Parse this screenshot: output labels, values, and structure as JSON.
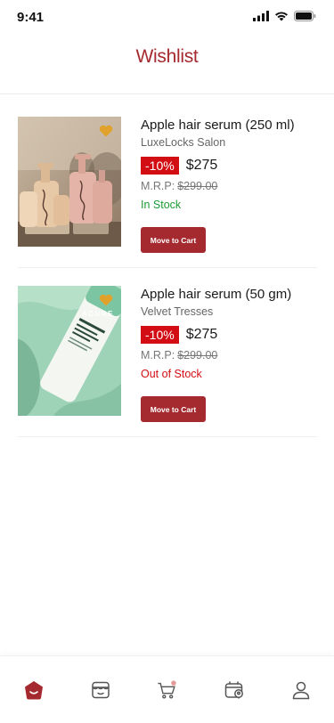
{
  "status": {
    "time": "9:41",
    "icons": [
      "signal-icon",
      "wifi-icon",
      "battery-icon"
    ]
  },
  "header": {
    "title": "Wishlist"
  },
  "colors": {
    "brand": "#a52a2f",
    "discount_bg": "#d30d14",
    "in_stock": "#1e9b33",
    "out_of_stock": "#d30d14",
    "heart": "#e0a22a"
  },
  "items": [
    {
      "title": "Apple hair serum (250 ml)",
      "seller": "LuxeLocks Salon",
      "discount": "-10%",
      "price": "$275",
      "mrp_label": "M.R.P:",
      "mrp_value": "$299.00",
      "stock": "In Stock",
      "button": "Move to Cart"
    },
    {
      "title": "Apple hair serum (50 gm)",
      "seller": "Velvet Tresses",
      "discount": "-10%",
      "price": "$275",
      "mrp_label": "M.R.P:",
      "mrp_value": "$299.00",
      "stock": "Out of Stock",
      "button": "Move to Cart",
      "image_text": "ACURE"
    }
  ],
  "bottom_nav": [
    {
      "icon": "home-icon",
      "active": true
    },
    {
      "icon": "store-icon",
      "active": false
    },
    {
      "icon": "cart-icon",
      "active": false
    },
    {
      "icon": "orders-icon",
      "active": false
    },
    {
      "icon": "profile-icon",
      "active": false
    }
  ]
}
